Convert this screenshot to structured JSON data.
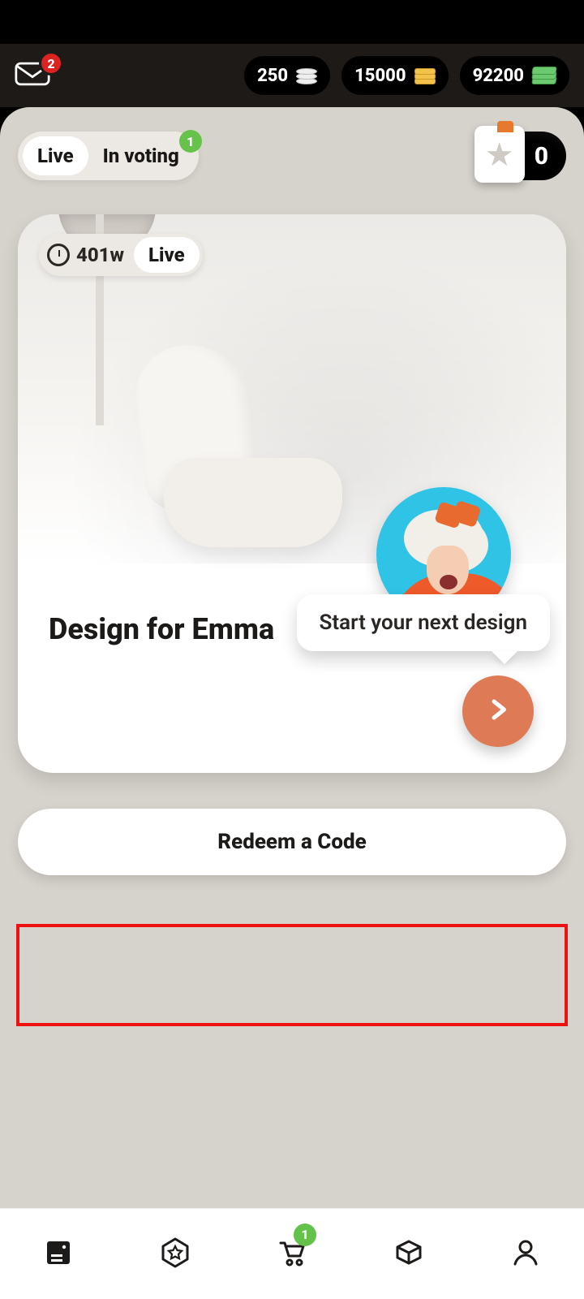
{
  "header": {
    "mail_badge": "2",
    "currencies": [
      {
        "amount": "250",
        "icon": "coins"
      },
      {
        "amount": "15000",
        "icon": "gold"
      },
      {
        "amount": "92200",
        "icon": "cash"
      }
    ]
  },
  "tabs": {
    "live": "Live",
    "in_voting": "In voting",
    "in_voting_badge": "1"
  },
  "star_counter": "0",
  "card": {
    "timer": "401w",
    "status": "Live",
    "title": "Design for Emma",
    "tooltip": "Start your next design"
  },
  "redeem_label": "Redeem a Code",
  "bottom_nav": {
    "cart_badge": "1"
  }
}
